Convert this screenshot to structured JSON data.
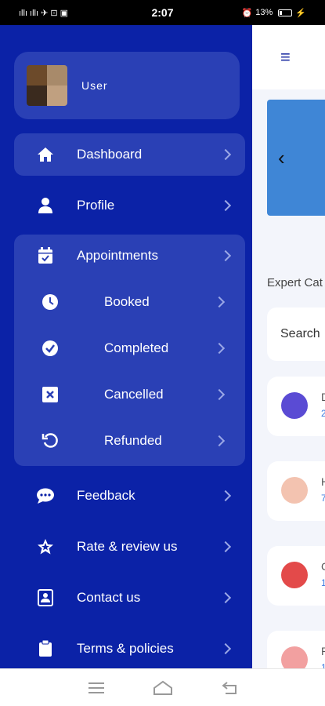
{
  "status_bar": {
    "time": "2:07",
    "left_indicators": "ıllı ıllı ✈ ⊡ ▣",
    "battery": "13%"
  },
  "drawer": {
    "user": {
      "name": "User"
    },
    "items": [
      {
        "label": "Dashboard",
        "icon": "home-icon"
      },
      {
        "label": "Profile",
        "icon": "person-icon"
      },
      {
        "label": "Appointments",
        "icon": "calendar-icon"
      },
      {
        "label": "Feedback",
        "icon": "chat-icon"
      },
      {
        "label": "Rate & review us",
        "icon": "star-icon"
      },
      {
        "label": "Contact us",
        "icon": "contact-icon"
      },
      {
        "label": "Terms & policies",
        "icon": "clipboard-icon"
      }
    ],
    "sub_items": [
      {
        "label": "Booked",
        "icon": "clock-icon"
      },
      {
        "label": "Completed",
        "icon": "check-circle-icon"
      },
      {
        "label": "Cancelled",
        "icon": "cancel-icon"
      },
      {
        "label": "Refunded",
        "icon": "refund-icon"
      }
    ]
  },
  "background": {
    "menu_glyph": "≡",
    "banner_arrow": "‹",
    "section_title": "Expert Cat",
    "search_placeholder": "Search",
    "categories": [
      {
        "l1": "D",
        "l2": "2"
      },
      {
        "l1": "H",
        "l2": "7"
      },
      {
        "l1": "C",
        "l2": "1"
      },
      {
        "l1": "P",
        "l2": "1"
      }
    ]
  },
  "colors": {
    "drawer": "#0b22a7",
    "drawer_highlight": "#2a40b5",
    "accent": "#3f86d6"
  }
}
